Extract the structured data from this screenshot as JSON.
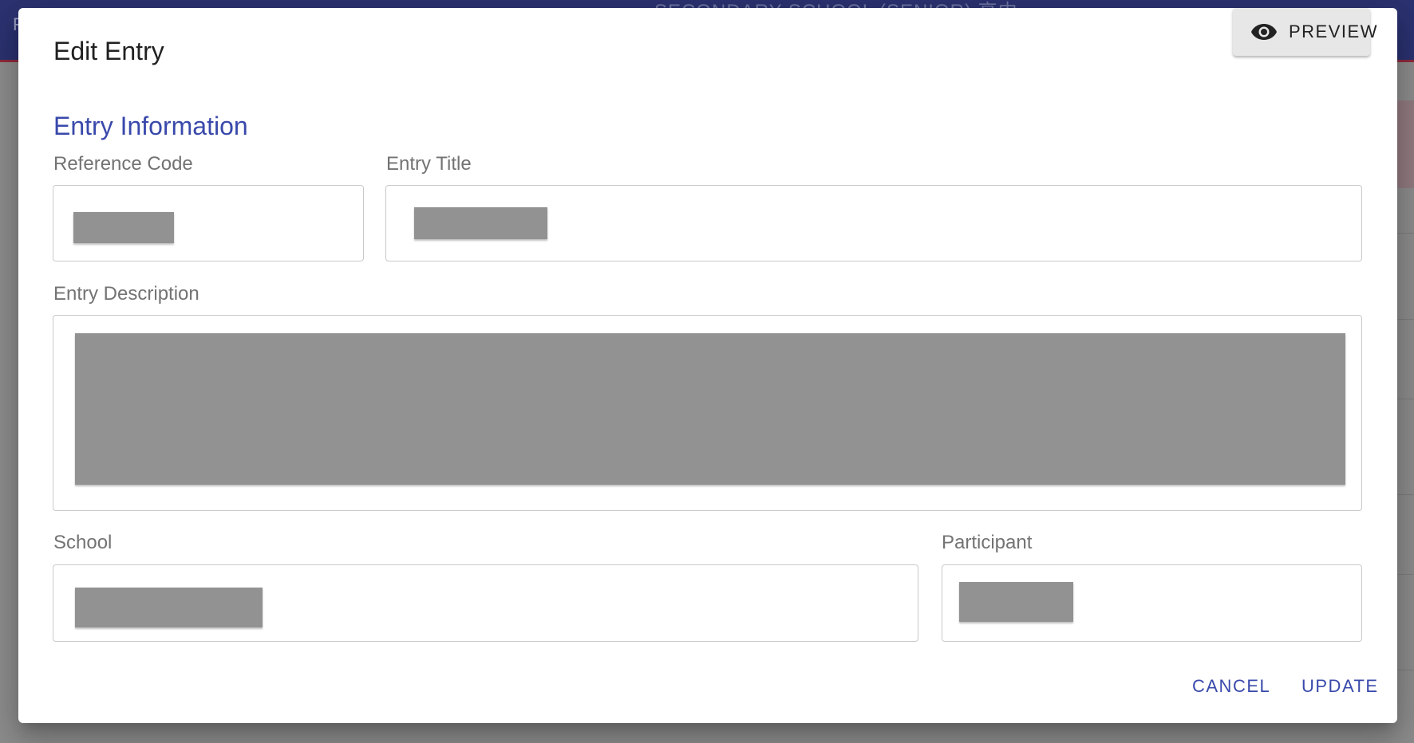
{
  "app": {
    "header_text": "SECONDARY SCHOOL (SENIOR) 高中",
    "header_letter": "F"
  },
  "dialog": {
    "title": "Edit Entry",
    "preview_button": {
      "label": "PREVIEW",
      "icon": "eye-icon"
    },
    "section_title": "Entry Information",
    "fields": {
      "reference_code": {
        "label": "Reference Code",
        "value": ""
      },
      "entry_title": {
        "label": "Entry Title",
        "value": ""
      },
      "entry_description": {
        "label": "Entry Description",
        "value": ""
      },
      "school": {
        "label": "School",
        "value": ""
      },
      "participant": {
        "label": "Participant",
        "value": ""
      }
    },
    "actions": {
      "cancel": "CANCEL",
      "update": "UPDATE"
    }
  },
  "colors": {
    "accent": "#3949ab",
    "appbar": "#2b3270",
    "redaction": "#929292"
  }
}
